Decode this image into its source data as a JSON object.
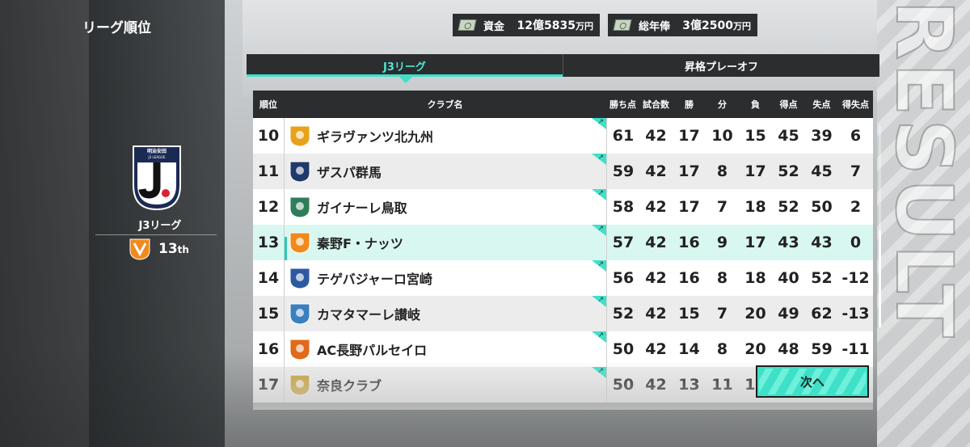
{
  "page_title": "リーグ順位",
  "funds": {
    "label": "資金",
    "value": "12億5835",
    "unit": "万円"
  },
  "salary": {
    "label": "総年俸",
    "value": "3億2500",
    "unit": "万円"
  },
  "tabs": [
    {
      "label": "J3リーグ",
      "active": true
    },
    {
      "label": "昇格プレーオフ",
      "active": false
    }
  ],
  "league": {
    "logo_top_text": "明治安田",
    "logo_sub_text": "J3 LEAGUE",
    "name": "J3リーグ"
  },
  "my_club": {
    "rank": "13",
    "suffix": "th"
  },
  "table": {
    "headers": [
      "順位",
      "クラブ名",
      "勝ち点",
      "試合数",
      "勝",
      "分",
      "負",
      "得点",
      "失点",
      "得失点"
    ],
    "rows": [
      {
        "rank": "10",
        "club": "ギラヴァンツ北九州",
        "pts": "61",
        "played": "42",
        "w": "17",
        "d": "10",
        "l": "15",
        "gf": "45",
        "ga": "39",
        "gd": "6",
        "emblem_color": "#e8a21a"
      },
      {
        "rank": "11",
        "club": "ザスパ群馬",
        "pts": "59",
        "played": "42",
        "w": "17",
        "d": "8",
        "l": "17",
        "gf": "52",
        "ga": "45",
        "gd": "7",
        "emblem_color": "#1f3a6b"
      },
      {
        "rank": "12",
        "club": "ガイナーレ鳥取",
        "pts": "58",
        "played": "42",
        "w": "17",
        "d": "7",
        "l": "18",
        "gf": "52",
        "ga": "50",
        "gd": "2",
        "emblem_color": "#2e7d5b"
      },
      {
        "rank": "13",
        "club": "秦野F・ナッツ",
        "pts": "57",
        "played": "42",
        "w": "16",
        "d": "9",
        "l": "17",
        "gf": "43",
        "ga": "43",
        "gd": "0",
        "emblem_color": "#f08a1c",
        "highlight": true
      },
      {
        "rank": "14",
        "club": "テゲバジャーロ宮崎",
        "pts": "56",
        "played": "42",
        "w": "16",
        "d": "8",
        "l": "18",
        "gf": "40",
        "ga": "52",
        "gd": "-12",
        "emblem_color": "#2c5aa0"
      },
      {
        "rank": "15",
        "club": "カマタマーレ讃岐",
        "pts": "52",
        "played": "42",
        "w": "15",
        "d": "7",
        "l": "20",
        "gf": "49",
        "ga": "62",
        "gd": "-13",
        "emblem_color": "#3a7fc0"
      },
      {
        "rank": "16",
        "club": "AC長野パルセイロ",
        "pts": "50",
        "played": "42",
        "w": "14",
        "d": "8",
        "l": "20",
        "gf": "48",
        "ga": "59",
        "gd": "-11",
        "emblem_color": "#e06a1a"
      },
      {
        "rank": "17",
        "club": "奈良クラブ",
        "pts": "50",
        "played": "42",
        "w": "13",
        "d": "11",
        "l": "18",
        "gf": "",
        "ga": "",
        "gd": "",
        "emblem_color": "#c8a23a"
      }
    ]
  },
  "next_button": "次へ",
  "bg_text": "RESULT",
  "colors": {
    "accent": "#3fe0c8",
    "highlight_row": "#d9f7f1",
    "panel_dark": "#2b2d2f"
  }
}
